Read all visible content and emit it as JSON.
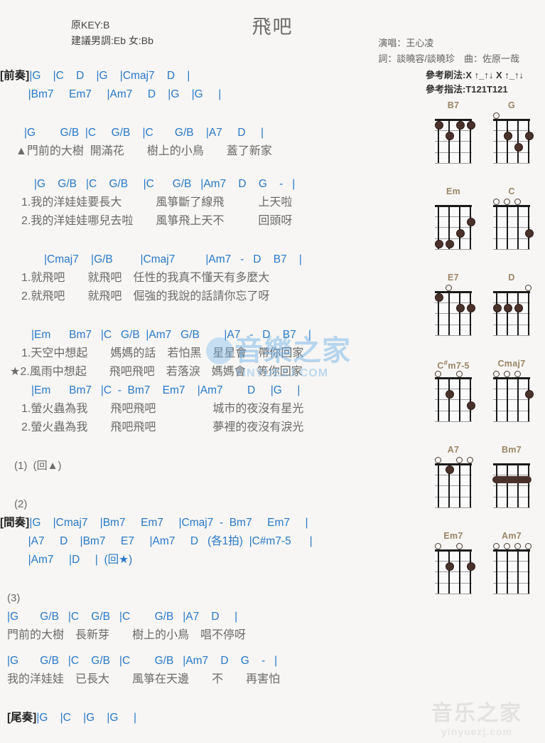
{
  "header": {
    "title": "飛吧",
    "key_original": "原KEY:B",
    "key_suggested": "建議男調:Eb 女:Bb",
    "singer": "演唱：王心凌",
    "writers": "詞：談曉容/談曉珍　曲：佐原一哉",
    "strum_pattern": "參考刷法:X ↑_↑↓ X ↑_↑↓",
    "finger_pattern": "參考指法:T121T121"
  },
  "sections": {
    "intro_tag": "[前奏]",
    "intro_line1": "|G    |C    D    |G    |Cmaj7    D    |",
    "intro_line2": "|Bm7     Em7     |Am7     D    |G    |G     |",
    "verse_a_chords": "|G        G/B  |C     G/B    |C       G/B    |A7     D     |",
    "verse_a_lyric": "▲門前的大樹  開滿花　　樹上的小鳥　　蓋了新家",
    "verse_b_chords": "|G    G/B   |C    G/B     |C      G/B   |Am7    D    G    -   |",
    "verse_b_lyric1": "1.我的洋娃娃要長大　　　風箏斷了線飛　　　上天啦",
    "verse_b_lyric2": "2.我的洋娃娃哪兒去啦　　風箏飛上天不　　　回頭呀",
    "pre_chorus_chords": "|Cmaj7    |G/B         |Cmaj7          |Am7   -   D    B7    |",
    "pre_chorus_lyric1": "1.就飛吧　　就飛吧　任性的我真不懂天有多麼大",
    "pre_chorus_lyric2": "2.就飛吧　　就飛吧　倔強的我說的話請你忘了呀",
    "chorus_a_chords": "|Em      Bm7   |C   G/B  |Am7   G/B        |A7   -   D    B7    |",
    "chorus_a_lyric1": "1.天空中想起　　媽媽的話　若怕黑　星星會　帶你回家",
    "chorus_a_lyric2": "★2.風雨中想起　　飛吧飛吧　若落淚　媽媽會　等你回家",
    "chorus_b_chords": "|Em      Bm7   |C  -  Bm7    Em7    |Am7        D     |G     |",
    "chorus_b_lyric1": "1.螢火蟲為我　　飛吧飛吧　　　　　城市的夜沒有星光",
    "chorus_b_lyric2": "2.螢火蟲為我　　飛吧飛吧　　　　　夢裡的夜沒有淚光",
    "repeat_1": "(1)  (回▲)",
    "repeat_2": "(2)",
    "interlude_tag": "[間奏]",
    "interlude_line1": "|G    |Cmaj7    |Bm7     Em7     |Cmaj7  -  Bm7     Em7     |",
    "interlude_line2": "|A7     D    |Bm7     E7     |Am7     D   (各1拍)  |C#m7-5      |",
    "interlude_line3": "|Am7     |D     |  (回★)",
    "repeat_3": "(3)",
    "verse_c_chords": "|G       G/B   |C    G/B   |C        G/B   |A7    D     |",
    "verse_c_lyric": "門前的大樹　長新芽　　樹上的小鳥　唱不停呀",
    "verse_d_chords": "|G       G/B   |C    G/B   |C        G/B   |Am7    D    G    -   |",
    "verse_d_lyric": "我的洋娃娃　已長大　　風箏在天邊　　不　　再害怕",
    "outro_tag": "[尾奏]",
    "outro_line": "|G    |C    |G    |G     |"
  },
  "chord_diagrams": [
    {
      "name": "B7",
      "sharp": "",
      "open": [],
      "dots": [
        {
          "s": 1,
          "f": 1
        },
        {
          "s": 3,
          "f": 1
        },
        {
          "s": 4,
          "f": 1
        },
        {
          "s": 2,
          "f": 2
        }
      ],
      "barre": null
    },
    {
      "name": "G",
      "sharp": "",
      "open": [
        1
      ],
      "dots": [
        {
          "s": 2,
          "f": 2
        },
        {
          "s": 4,
          "f": 2
        },
        {
          "s": 3,
          "f": 3
        }
      ],
      "barre": null
    },
    {
      "name": "Em",
      "sharp": "",
      "open": [],
      "dots": [
        {
          "s": 4,
          "f": 2
        },
        {
          "s": 3,
          "f": 3
        },
        {
          "s": 1,
          "f": 4
        },
        {
          "s": 2,
          "f": 4
        }
      ],
      "barre": null
    },
    {
      "name": "C",
      "sharp": "",
      "open": [
        1,
        2,
        3
      ],
      "dots": [
        {
          "s": 4,
          "f": 3
        }
      ],
      "barre": null
    },
    {
      "name": "E7",
      "sharp": "",
      "open": [
        2
      ],
      "dots": [
        {
          "s": 1,
          "f": 1
        },
        {
          "s": 3,
          "f": 2
        },
        {
          "s": 4,
          "f": 2
        }
      ],
      "barre": null
    },
    {
      "name": "D",
      "sharp": "",
      "open": [
        4
      ],
      "dots": [
        {
          "s": 1,
          "f": 2
        },
        {
          "s": 2,
          "f": 2
        },
        {
          "s": 3,
          "f": 2
        }
      ],
      "barre": null
    },
    {
      "name": "C#m7-5",
      "sharp": "#",
      "open": [
        1,
        3
      ],
      "dots": [
        {
          "s": 2,
          "f": 2
        },
        {
          "s": 4,
          "f": 3
        }
      ],
      "barre": null
    },
    {
      "name": "Cmaj7",
      "sharp": "",
      "open": [
        1,
        2,
        3
      ],
      "dots": [
        {
          "s": 4,
          "f": 2
        }
      ],
      "barre": null
    },
    {
      "name": "A7",
      "sharp": "",
      "open": [
        1,
        3,
        4
      ],
      "dots": [
        {
          "s": 2,
          "f": 1
        }
      ],
      "barre": null
    },
    {
      "name": "Bm7",
      "sharp": "",
      "open": [],
      "dots": [],
      "barre": {
        "f": 2,
        "from": 1,
        "to": 4
      }
    },
    {
      "name": "Em7",
      "sharp": "",
      "open": [
        1,
        3
      ],
      "dots": [
        {
          "s": 2,
          "f": 2
        },
        {
          "s": 4,
          "f": 2
        }
      ],
      "barre": null
    },
    {
      "name": "Am7",
      "sharp": "",
      "open": [
        1,
        2,
        3,
        4
      ],
      "dots": [],
      "barre": null
    }
  ],
  "watermarks": {
    "center_cn": "音樂之家",
    "center_en": "YINYUEZJ.COM",
    "bottom_cn": "音乐之家",
    "bottom_en": "yinyuezj.com"
  }
}
